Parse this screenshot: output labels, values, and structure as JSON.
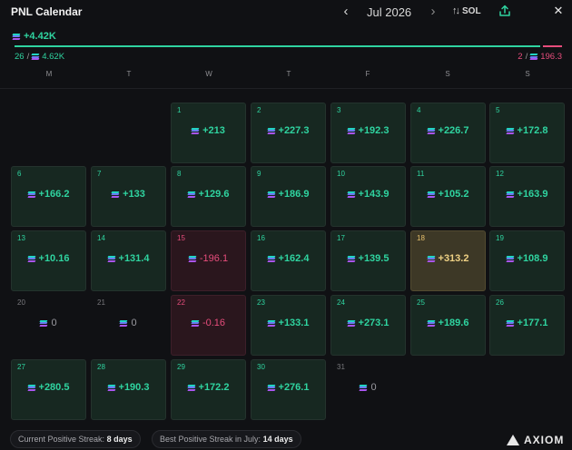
{
  "header": {
    "title": "PNL Calendar",
    "month": "Jul 2026",
    "currency": "SOL"
  },
  "summary": {
    "total": "+4.42K",
    "positive_days": "26",
    "positive_total": "4.62K",
    "negative_days": "2",
    "negative_total": "196.3",
    "positive_share": 0.96
  },
  "weekdays": [
    "M",
    "T",
    "W",
    "T",
    "F",
    "S",
    "S"
  ],
  "days": [
    {
      "day": "1",
      "pnl": "+213",
      "kind": "pos"
    },
    {
      "day": "2",
      "pnl": "+227.3",
      "kind": "pos"
    },
    {
      "day": "3",
      "pnl": "+192.3",
      "kind": "pos"
    },
    {
      "day": "4",
      "pnl": "+226.7",
      "kind": "pos"
    },
    {
      "day": "5",
      "pnl": "+172.8",
      "kind": "pos"
    },
    {
      "day": "6",
      "pnl": "+166.2",
      "kind": "pos"
    },
    {
      "day": "7",
      "pnl": "+133",
      "kind": "pos"
    },
    {
      "day": "8",
      "pnl": "+129.6",
      "kind": "pos"
    },
    {
      "day": "9",
      "pnl": "+186.9",
      "kind": "pos"
    },
    {
      "day": "10",
      "pnl": "+143.9",
      "kind": "pos"
    },
    {
      "day": "11",
      "pnl": "+105.2",
      "kind": "pos"
    },
    {
      "day": "12",
      "pnl": "+163.9",
      "kind": "pos"
    },
    {
      "day": "13",
      "pnl": "+10.16",
      "kind": "pos"
    },
    {
      "day": "14",
      "pnl": "+131.4",
      "kind": "pos"
    },
    {
      "day": "15",
      "pnl": "-196.1",
      "kind": "neg"
    },
    {
      "day": "16",
      "pnl": "+162.4",
      "kind": "pos"
    },
    {
      "day": "17",
      "pnl": "+139.5",
      "kind": "pos"
    },
    {
      "day": "18",
      "pnl": "+313.2",
      "kind": "big"
    },
    {
      "day": "19",
      "pnl": "+108.9",
      "kind": "pos"
    },
    {
      "day": "20",
      "pnl": "0",
      "kind": "zero"
    },
    {
      "day": "21",
      "pnl": "0",
      "kind": "zero"
    },
    {
      "day": "22",
      "pnl": "-0.16",
      "kind": "neg"
    },
    {
      "day": "23",
      "pnl": "+133.1",
      "kind": "pos"
    },
    {
      "day": "24",
      "pnl": "+273.1",
      "kind": "pos"
    },
    {
      "day": "25",
      "pnl": "+189.6",
      "kind": "pos"
    },
    {
      "day": "26",
      "pnl": "+177.1",
      "kind": "pos"
    },
    {
      "day": "27",
      "pnl": "+280.5",
      "kind": "pos"
    },
    {
      "day": "28",
      "pnl": "+190.3",
      "kind": "pos"
    },
    {
      "day": "29",
      "pnl": "+172.2",
      "kind": "pos"
    },
    {
      "day": "30",
      "pnl": "+276.1",
      "kind": "pos"
    },
    {
      "day": "31",
      "pnl": "0",
      "kind": "zero"
    }
  ],
  "footer": {
    "current_streak_label": "Current Positive Streak:",
    "current_streak_value": "8 days",
    "best_streak_label": "Best Positive Streak in July:",
    "best_streak_value": "14 days",
    "brand": "AXIOM"
  },
  "colors": {
    "positive": "#2fd4a0",
    "negative": "#e74d7c",
    "highlight": "#efd184"
  }
}
